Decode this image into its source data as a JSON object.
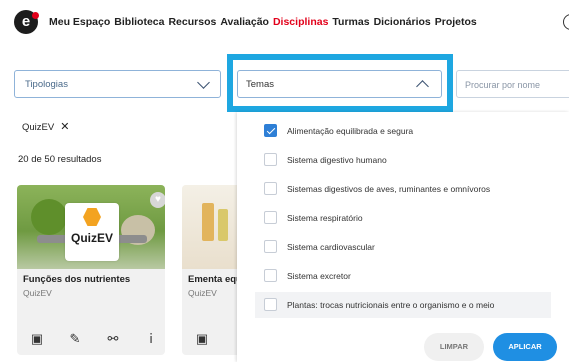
{
  "nav": {
    "logo_text": "e",
    "items": [
      "Meu Espaço",
      "Biblioteca",
      "Recursos",
      "Avaliação",
      "Disciplinas",
      "Turmas",
      "Dicionários",
      "Projetos"
    ],
    "active": "Disciplinas"
  },
  "filters": {
    "tipologias_label": "Tipologias",
    "temas_label": "Temas",
    "search_placeholder": "Procurar por nome"
  },
  "chip": {
    "label": "QuizEV",
    "remove": "✕"
  },
  "results_text": "20 de 50 resultados",
  "cards": [
    {
      "badge": "QuizEV",
      "title": "Funções dos nutrientes",
      "subtitle": "QuizEV"
    },
    {
      "title": "Ementa equi",
      "subtitle": "QuizEV"
    }
  ],
  "temas_options": [
    {
      "label": "Alimentação equilibrada e segura",
      "checked": true
    },
    {
      "label": "Sistema digestivo humano",
      "checked": false
    },
    {
      "label": "Sistemas digestivos de aves, ruminantes e omnívoros",
      "checked": false
    },
    {
      "label": "Sistema respiratório",
      "checked": false
    },
    {
      "label": "Sistema cardiovascular",
      "checked": false
    },
    {
      "label": "Sistema excretor",
      "checked": false
    },
    {
      "label": "Plantas: trocas nutricionais entre o organismo e o meio",
      "checked": false
    }
  ],
  "buttons": {
    "limpar": "LIMPAR",
    "aplicar": "APLICAR"
  },
  "colors": {
    "accent_red": "#e2001a",
    "highlight_blue": "#1ea7e1",
    "primary_blue": "#1f8fe3"
  }
}
